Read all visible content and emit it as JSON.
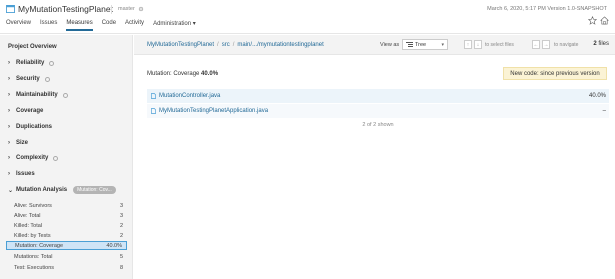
{
  "header": {
    "project_name": "MyMutationTestingPlanet",
    "branch": "master",
    "date_version": "March 6, 2020, 5:17 PM  Version 1.0-SNAPSHOT",
    "tabs": [
      {
        "label": "Overview"
      },
      {
        "label": "Issues"
      },
      {
        "label": "Measures"
      },
      {
        "label": "Code"
      },
      {
        "label": "Activity"
      },
      {
        "label": "Administration ▾"
      }
    ]
  },
  "sidebar": {
    "title": "Project Overview",
    "domains": [
      {
        "label": "Reliability"
      },
      {
        "label": "Security"
      },
      {
        "label": "Maintainability"
      },
      {
        "label": "Coverage"
      },
      {
        "label": "Duplications"
      },
      {
        "label": "Size"
      },
      {
        "label": "Complexity"
      },
      {
        "label": "Issues"
      },
      {
        "label": "Mutation Analysis",
        "badge": "Mutation: Cov..."
      }
    ],
    "metrics": [
      {
        "label": "Alive: Survivors",
        "value": "3"
      },
      {
        "label": "Alive: Total",
        "value": "3"
      },
      {
        "label": "Killed: Total",
        "value": "2"
      },
      {
        "label": "Killed: by Tests",
        "value": "2"
      },
      {
        "label": "Mutation: Coverage",
        "value": "40.0%"
      },
      {
        "label": "Mutations: Total",
        "value": "5"
      },
      {
        "label": "Test: Executions",
        "value": "8"
      }
    ]
  },
  "main": {
    "breadcrumb": [
      "MyMutationTestingPlanet",
      "src",
      "main/.../mymutationtestingplanet"
    ],
    "view_as_label": "View as",
    "view_select": "Tree",
    "select_hint": "to select files",
    "navigate_hint": "to navigate",
    "file_count": "2",
    "file_count_label": "files",
    "metric_label": "Mutation: Coverage",
    "metric_value": "40.0%",
    "new_code": "New code: since previous version",
    "files": [
      {
        "name": "MutationController.java",
        "value": "40.0%"
      },
      {
        "name": "MyMutationTestingPlanetApplication.java",
        "value": "–"
      }
    ],
    "shown": "2 of 2 shown"
  },
  "colors": {
    "accent": "#236a97",
    "selected_bg": "#cfe4f6",
    "new_code_bg": "#fbf3d5"
  }
}
